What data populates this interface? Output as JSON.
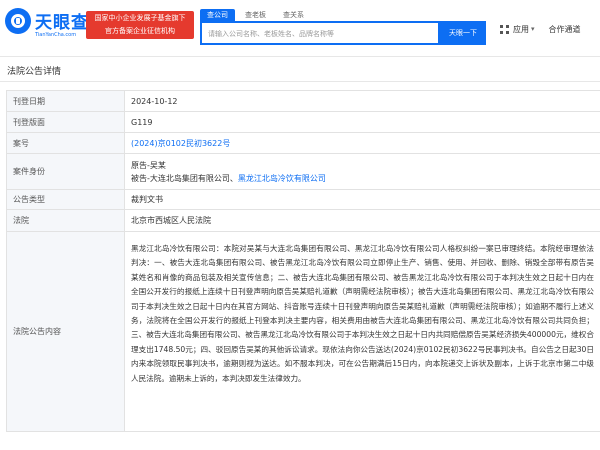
{
  "brand": {
    "logo_cn": "天眼查",
    "logo_en": "TianYanCha.com",
    "banner_line1": "国家中小企业发展子基金旗下",
    "banner_line2": "官方备案企业征信机构",
    "colors": {
      "brand_blue": "#0d6ef3",
      "banner_red": "#e53a2e"
    }
  },
  "search": {
    "tabs": [
      "查公司",
      "查老板",
      "查关系"
    ],
    "active_tab": 0,
    "placeholder": "请输入公司名称、老板姓名、品牌名称等",
    "button_label": "天眼一下"
  },
  "nav": {
    "app_label": "应用",
    "coop_label": "合作通道",
    "icons": [
      "grid-icon",
      "chevron-down-icon"
    ]
  },
  "page": {
    "title": "法院公告详情"
  },
  "detail": {
    "rows": [
      {
        "key": "刊登日期",
        "value": "2024-10-12"
      },
      {
        "key": "刊登版面",
        "value": "G119"
      },
      {
        "key": "案号",
        "value": "(2024)京0102民初3622号"
      },
      {
        "key": "案件身份",
        "party1": "原告-吴某",
        "party2_prefix": "被告-大连北岛集团有限公司、",
        "party2_link": "黑龙江北岛冷饮有限公司"
      },
      {
        "key": "公告类型",
        "value": "裁判文书"
      },
      {
        "key": "法院",
        "value": "北京市西城区人民法院"
      },
      {
        "key": "法院公告内容",
        "value": "黑龙江北岛冷饮有限公司：本院对吴某与大连北岛集团有限公司、黑龙江北岛冷饮有限公司人格权纠纷一案已审理终结。本院经审理依法判决：一、被告大连北岛集团有限公司、被告黑龙江北岛冷饮有限公司立即停止生产、销售、使用、并回收、删除、销毁全部带有原告吴某姓名和肖像的商品包装及相关宣传信息；二、被告大连北岛集团有限公司、被告黑龙江北岛冷饮有限公司于本判决生效之日起十日内在全国公开发行的报纸上连续十日刊登声明向原告吴某赔礼道歉（声明需经法院审核）；被告大连北岛集团有限公司、黑龙江北岛冷饮有限公司于本判决生效之日起十日内在其官方网站、抖音账号连续十日刊登声明向原告吴某赔礼道歉（声明需经法院审核）；如逾期不履行上述义务，法院将在全国公开发行的报纸上刊登本判决主要内容，相关费用由被告大连北岛集团有限公司、黑龙江北岛冷饮有限公司共同负担；三、被告大连北岛集团有限公司、被告黑龙江北岛冷饮有限公司于本判决生效之日起十日内共同赔偿原告吴某经济损失400000元，维权合理支出1748.50元；四、驳回原告吴某的其他诉讼请求。现依法向你公告送达(2024)京0102民初3622号民事判决书。自公告之日起30日内来本院领取民事判决书，逾期则视为送达。如不服本判决，可在公告期满后15日内，向本院递交上诉状及副本，上诉于北京市第二中级人民法院。逾期未上诉的，本判决即发生法律效力。"
      }
    ]
  }
}
